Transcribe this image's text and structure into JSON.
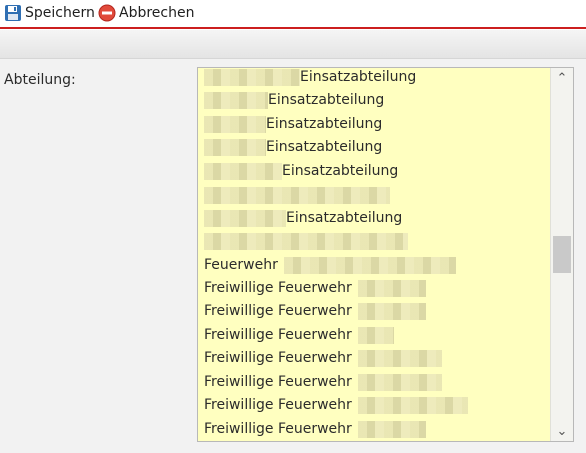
{
  "toolbar": {
    "save_label": "Speichern",
    "cancel_label": "Abbrechen",
    "save_icon": "floppy-disk-icon",
    "cancel_icon": "stop-icon",
    "accent": "#cc1f1f"
  },
  "form": {
    "department_label": "Abteilung:"
  },
  "list": {
    "background": "#ffffc0",
    "items": [
      {
        "text": "Einsatzabteilung"
      },
      {
        "text": "Einsatzabteilung"
      },
      {
        "text": "Einsatzabteilung"
      },
      {
        "text": "Einsatzabteilung"
      },
      {
        "text": "Einsatzabteilung"
      },
      {
        "text": ""
      },
      {
        "text": "Einsatzabteilung"
      },
      {
        "text": ""
      },
      {
        "text": "Feuerwehr"
      },
      {
        "text": "Freiwillige Feuerwehr"
      },
      {
        "text": "Freiwillige Feuerwehr"
      },
      {
        "text": "Freiwillige Feuerwehr"
      },
      {
        "text": "Freiwillige Feuerwehr"
      },
      {
        "text": "Freiwillige Feuerwehr"
      },
      {
        "text": "Freiwillige Feuerwehr"
      },
      {
        "text": "Freiwillige Feuerwehr"
      }
    ]
  },
  "scrollbar": {
    "up_icon": "chevron-up-icon",
    "down_icon": "chevron-down-icon"
  }
}
